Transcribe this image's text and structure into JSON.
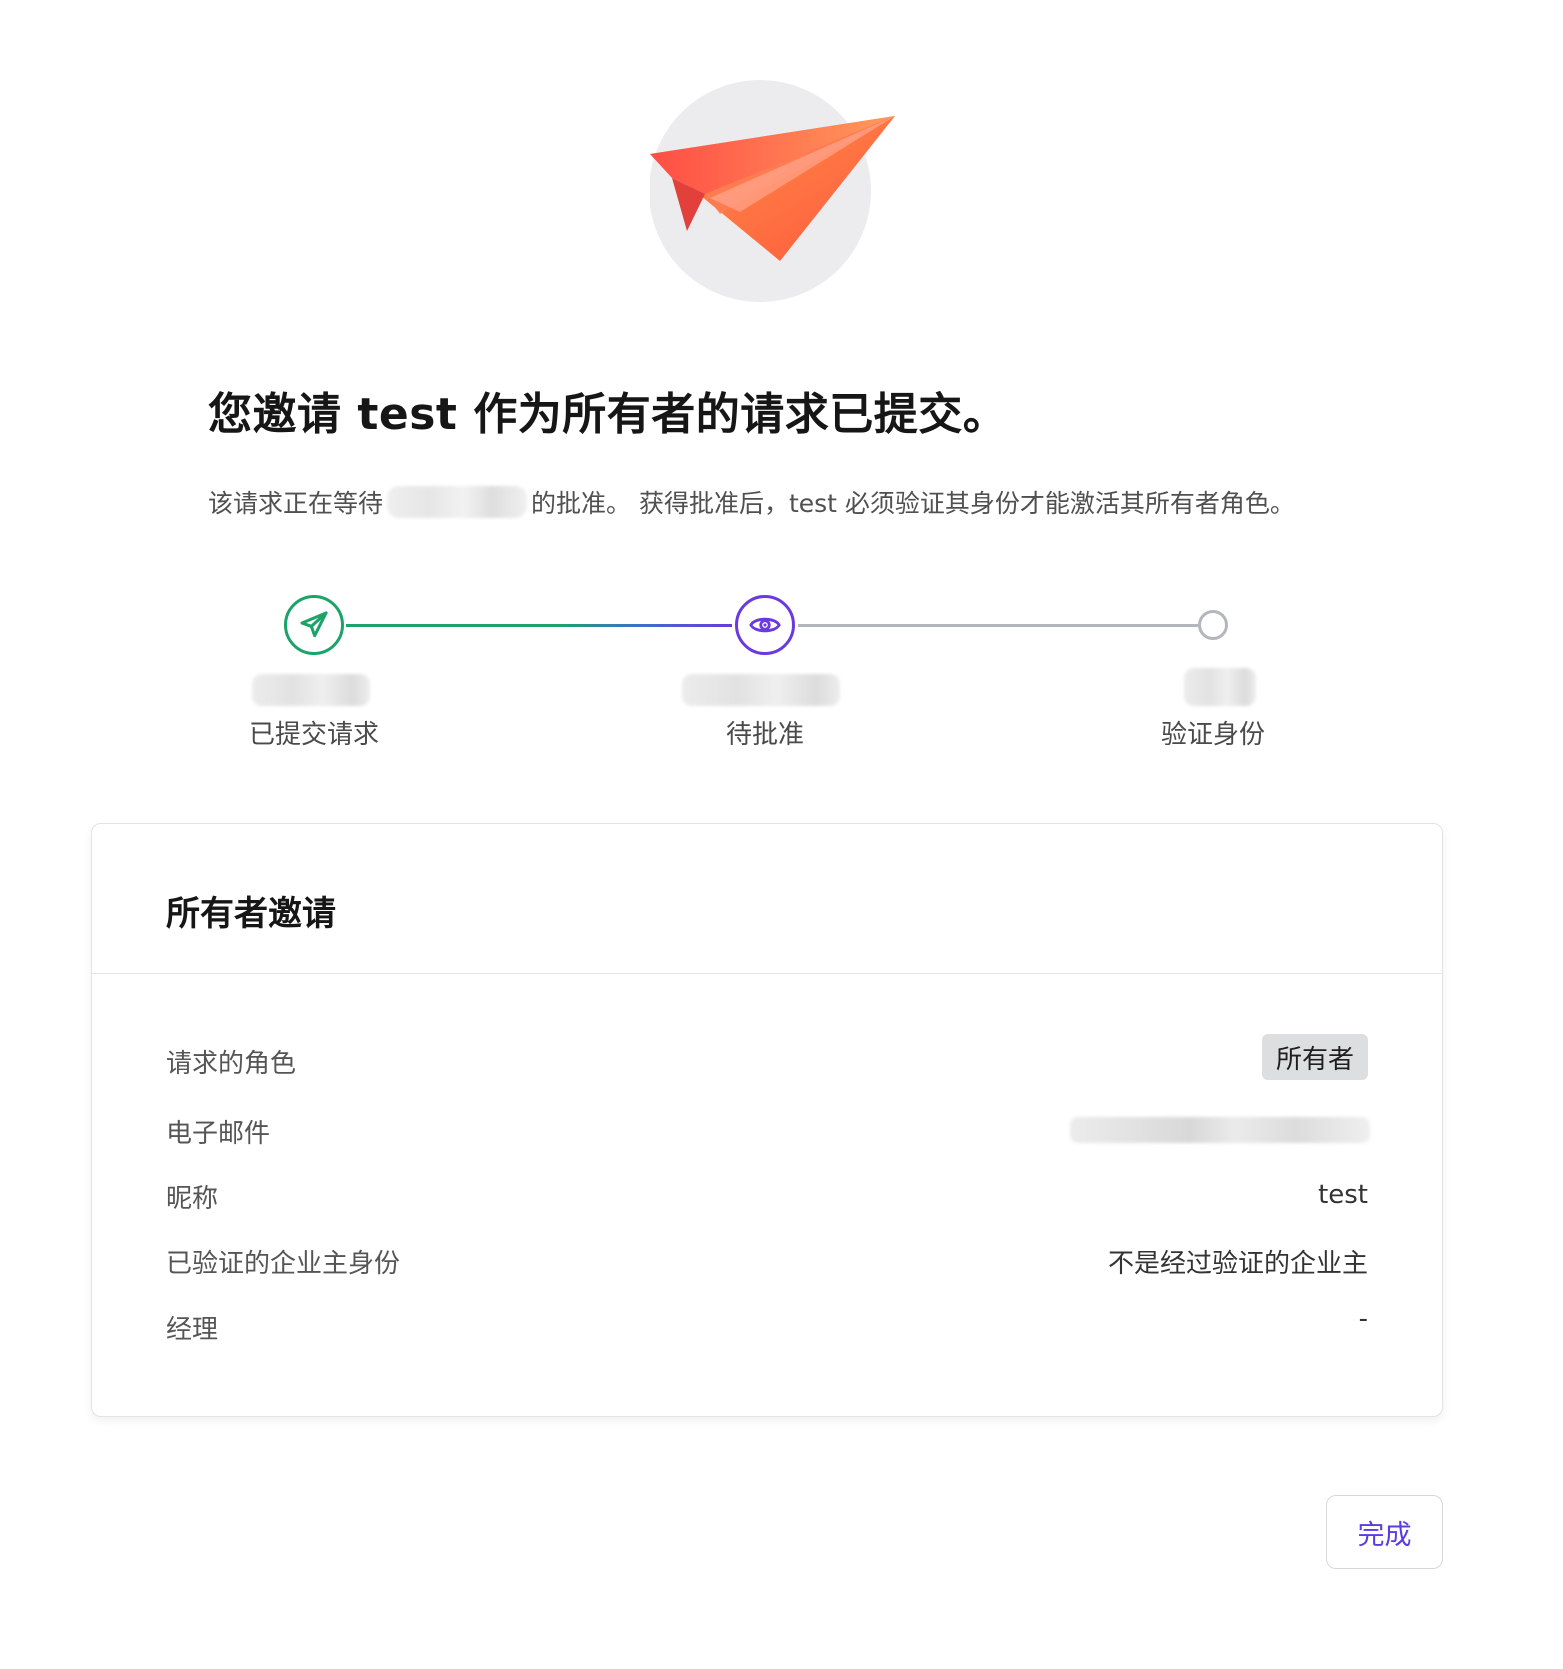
{
  "hero": {
    "icon": "paper-plane-icon"
  },
  "title": "您邀请 test 作为所有者的请求已提交。",
  "subtitle": {
    "before": "该请求正在等待",
    "after": "的批准。 获得批准后，test 必须验证其身份才能激活其所有者角色。"
  },
  "stepper": {
    "steps": [
      {
        "label": "已提交请求",
        "icon": "send-icon",
        "state": "done"
      },
      {
        "label": "待批准",
        "icon": "eye-icon",
        "state": "active"
      },
      {
        "label": "验证身份",
        "icon": "circle-icon",
        "state": "pending"
      }
    ]
  },
  "card": {
    "title": "所有者邀请",
    "rows": {
      "role": {
        "label": "请求的角色",
        "value": "所有者"
      },
      "email": {
        "label": "电子邮件"
      },
      "nickname": {
        "label": "昵称",
        "value": "test"
      },
      "verified": {
        "label": "已验证的企业主身份",
        "value": "不是经过验证的企业主"
      },
      "manager": {
        "label": "经理",
        "value": "-"
      }
    }
  },
  "actions": {
    "done_label": "完成"
  },
  "colors": {
    "success": "#1ba36a",
    "accent": "#6a3ae0",
    "pending": "#b3b6bb"
  }
}
